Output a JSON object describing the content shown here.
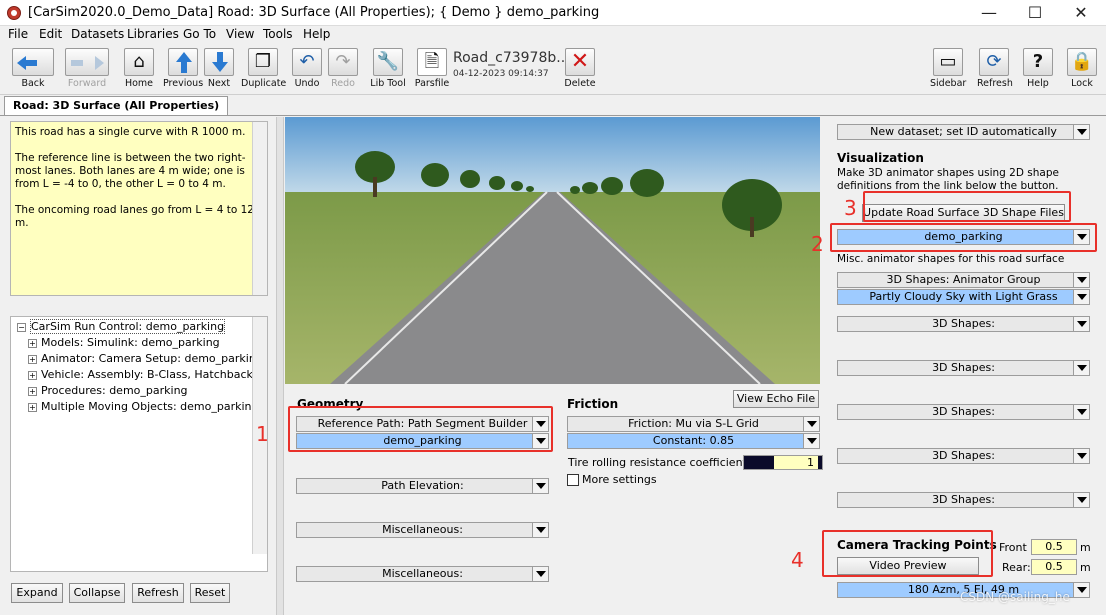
{
  "window": {
    "title": "[CarSim2020.0_Demo_Data] Road: 3D Surface (All Properties); { Demo } demo_parking",
    "minimize": "—",
    "maximize": "☐",
    "close": "✕"
  },
  "menu": {
    "items": [
      "File",
      "Edit",
      "Datasets",
      "Libraries",
      "Go To",
      "View",
      "Tools",
      "Help"
    ]
  },
  "toolbar": {
    "back": "Back",
    "forward": "Forward",
    "home": "Home",
    "previous": "Previous",
    "next": "Next",
    "duplicate": "Duplicate",
    "undo": "Undo",
    "redo": "Redo",
    "libtool": "Lib Tool",
    "parsfile": "Parsfile",
    "dataset_name": "Road_c73978b..",
    "dataset_date": "04-12-2023 09:14:37",
    "delete": "Delete",
    "sidebar": "Sidebar",
    "refresh": "Refresh",
    "help": "Help",
    "lock": "Lock"
  },
  "tab": {
    "label": "Road: 3D Surface (All Properties)"
  },
  "notes": {
    "p1": "This road has a single curve with R  1000 m.",
    "p2": "The reference line is between the two right-most lanes. Both lanes are 4 m wide; one is from L = -4 to 0, the other L = 0 to 4 m.",
    "p3": "The oncoming road lanes go from L = 4 to 12 m."
  },
  "tree": {
    "root": "CarSim Run Control: demo_parking",
    "children": [
      "Models: Simulink: demo_parking",
      "Animator: Camera Setup: demo_parking",
      "Vehicle: Assembly: B-Class, Hatchback",
      "Procedures: demo_parking",
      "Multiple Moving Objects: demo_parking"
    ]
  },
  "bottom_buttons": {
    "expand": "Expand",
    "collapse": "Collapse",
    "refresh": "Refresh",
    "reset": "Reset"
  },
  "view_echo": "View Echo File",
  "geometry": {
    "title": "Geometry",
    "ref_path": "Reference Path: Path Segment Builder",
    "ref_value": "demo_parking",
    "path_elevation": "Path Elevation:",
    "misc1": "Miscellaneous:",
    "misc2": "Miscellaneous:"
  },
  "friction": {
    "title": "Friction",
    "mu": "Friction: Mu via S-L Grid",
    "mu_value": "Constant: 0.85",
    "tire_label": "Tire rolling resistance coefficient:",
    "tire_value": "1",
    "more_settings": "More settings"
  },
  "right": {
    "new_dataset": "New dataset; set ID automatically",
    "vis_title": "Visualization",
    "vis_desc": "Make 3D animator shapes using 2D shape definitions from the link below the button.",
    "update_btn": "Update Road Surface 3D Shape Files",
    "shape_link": "demo_parking",
    "misc_label": "Misc. animator shapes for this road surface",
    "anim_group": "3D Shapes: Animator Group",
    "sky": "Partly Cloudy Sky with Light Grass",
    "shapes": [
      "3D Shapes:",
      "3D Shapes:",
      "3D Shapes:",
      "3D Shapes:",
      "3D Shapes:"
    ],
    "camera_title": "Camera Tracking Points",
    "video_preview": "Video Preview",
    "front_label": "Front",
    "front_value": "0.5",
    "rear_label": "Rear:",
    "rear_value": "0.5",
    "unit_m": "m",
    "camera_view": "180 Azm, 5 El, 49 m"
  },
  "annotations": {
    "n1": "1",
    "n2": "2",
    "n3": "3",
    "n4": "4"
  },
  "watermark": "CSDN @sailing_he"
}
